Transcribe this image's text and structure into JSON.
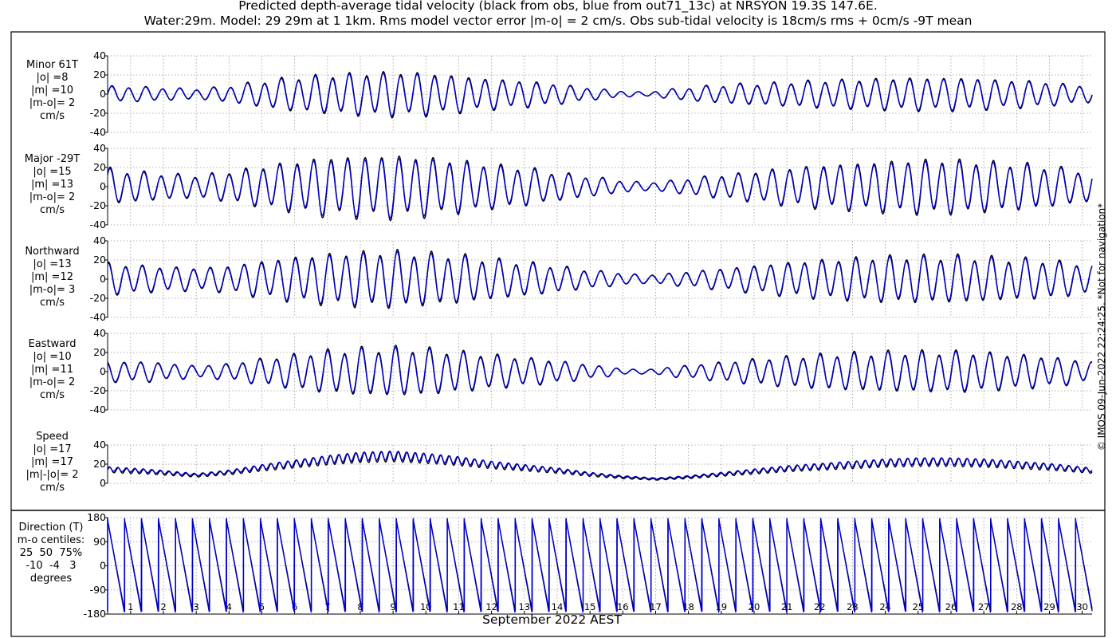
{
  "title": {
    "line1": "Predicted depth-average tidal velocity (black from obs, blue from out71_13c) at NRSYON 19.3S 147.6E.",
    "line2": "Water:29m. Model: 29 29m at 1 1km. Rms model vector error |m-o| = 2 cm/s. Obs sub-tidal velocity is 18cm/s rms + 0cm/s -9T mean"
  },
  "xlabel": "September 2022 AEST",
  "footer": "© IMOS 09-Jun-2022 22:24:25. *Not for navigation*",
  "colors": {
    "obs": "#000000",
    "model": "#0000cc",
    "grid": "#999999"
  },
  "panels": [
    {
      "id": "minor",
      "label_lines": [
        "Minor 61T",
        "|o| =8",
        "|m| =10",
        "|m-o|= 2",
        "cm/s"
      ],
      "yticks": [
        "40",
        "20",
        "0",
        "-20",
        "-40"
      ]
    },
    {
      "id": "major",
      "label_lines": [
        "Major -29T",
        "|o| =15",
        "|m| =13",
        "|m-o|= 2",
        "cm/s"
      ],
      "yticks": [
        "40",
        "20",
        "0",
        "-20",
        "-40"
      ]
    },
    {
      "id": "northward",
      "label_lines": [
        "Northward",
        "|o| =13",
        "|m| =12",
        "|m-o|= 3",
        "cm/s"
      ],
      "yticks": [
        "40",
        "20",
        "0",
        "-20",
        "-40"
      ]
    },
    {
      "id": "eastward",
      "label_lines": [
        "Eastward",
        "|o| =10",
        "|m| =11",
        "|m-o|= 2",
        "cm/s"
      ],
      "yticks": [
        "40",
        "20",
        "0",
        "-20",
        "-40"
      ]
    },
    {
      "id": "speed",
      "label_lines": [
        "Speed",
        "|o| =17",
        "|m| =17",
        "|m|-|o|= 2",
        "cm/s"
      ],
      "yticks": [
        "40",
        "20",
        "0"
      ]
    },
    {
      "id": "direction",
      "label_lines": [
        "Direction (T)",
        "m-o centiles:",
        "25  50  75%",
        "-10  -4   3",
        "degrees"
      ],
      "yticks": [
        "180",
        "90",
        "0",
        "-90",
        "-180"
      ]
    }
  ],
  "chart_data": {
    "type": "line",
    "x": {
      "label": "September 2022 AEST",
      "ticks": [
        "1",
        "2",
        "3",
        "4",
        "5",
        "6",
        "7",
        "8",
        "9",
        "10",
        "11",
        "12",
        "13",
        "14",
        "15",
        "16",
        "17",
        "18",
        "19",
        "20",
        "21",
        "22",
        "23",
        "24",
        "25",
        "26",
        "27",
        "28",
        "29",
        "30"
      ],
      "range_days": [
        0.3,
        30.3
      ]
    },
    "series_legend": [
      "black from obs",
      "blue from out71_13c"
    ],
    "panels": [
      {
        "name": "Minor 61T",
        "ylim": [
          -40,
          40
        ],
        "tidal_period_hours": 12.42,
        "amplitude_envelope_cm_s": [
          [
            0.3,
            8
          ],
          [
            1.5,
            7
          ],
          [
            3,
            5
          ],
          [
            4,
            8
          ],
          [
            5,
            13
          ],
          [
            6,
            17
          ],
          [
            7,
            19
          ],
          [
            8,
            21
          ],
          [
            9,
            22
          ],
          [
            10,
            21
          ],
          [
            11,
            18
          ],
          [
            12,
            15
          ],
          [
            13,
            13
          ],
          [
            14,
            10
          ],
          [
            15,
            6
          ],
          [
            16,
            3
          ],
          [
            16.7,
            2
          ],
          [
            17.5,
            5
          ],
          [
            18.5,
            8
          ],
          [
            19.5,
            10
          ],
          [
            20.5,
            11
          ],
          [
            21.5,
            13
          ],
          [
            22.5,
            14
          ],
          [
            23.5,
            15
          ],
          [
            24.5,
            16
          ],
          [
            25.5,
            16
          ],
          [
            26.5,
            16
          ],
          [
            27.5,
            14
          ],
          [
            28.5,
            13
          ],
          [
            29.5,
            10
          ],
          [
            30.3,
            8
          ]
        ]
      },
      {
        "name": "Major -29T",
        "ylim": [
          -40,
          40
        ],
        "tidal_period_hours": 12.42,
        "amplitude_envelope_cm_s": [
          [
            0.3,
            18
          ],
          [
            1.5,
            14
          ],
          [
            3,
            11
          ],
          [
            4,
            15
          ],
          [
            5,
            20
          ],
          [
            6,
            25
          ],
          [
            7,
            29
          ],
          [
            8,
            30
          ],
          [
            9,
            31
          ],
          [
            10,
            29
          ],
          [
            11,
            26
          ],
          [
            12,
            22
          ],
          [
            13,
            19
          ],
          [
            14,
            14
          ],
          [
            15,
            10
          ],
          [
            16,
            6
          ],
          [
            16.7,
            4
          ],
          [
            17.5,
            6
          ],
          [
            18.5,
            10
          ],
          [
            19.5,
            13
          ],
          [
            20.5,
            17
          ],
          [
            21.5,
            20
          ],
          [
            22.5,
            22
          ],
          [
            23.5,
            24
          ],
          [
            24.5,
            26
          ],
          [
            25.5,
            27
          ],
          [
            26.5,
            26
          ],
          [
            27.5,
            24
          ],
          [
            28.5,
            22
          ],
          [
            29.5,
            18
          ],
          [
            30.3,
            15
          ]
        ]
      },
      {
        "name": "Northward",
        "ylim": [
          -40,
          40
        ],
        "tidal_period_hours": 12.42,
        "amplitude_envelope_cm_s": [
          [
            0.3,
            16
          ],
          [
            1.5,
            13
          ],
          [
            3,
            11
          ],
          [
            4,
            13
          ],
          [
            5,
            18
          ],
          [
            6,
            22
          ],
          [
            7,
            25
          ],
          [
            8,
            27
          ],
          [
            9,
            28
          ],
          [
            10,
            26
          ],
          [
            11,
            24
          ],
          [
            12,
            20
          ],
          [
            13,
            17
          ],
          [
            14,
            13
          ],
          [
            15,
            9
          ],
          [
            16,
            6
          ],
          [
            16.7,
            4
          ],
          [
            17.5,
            6
          ],
          [
            18.5,
            9
          ],
          [
            19.5,
            12
          ],
          [
            20.5,
            15
          ],
          [
            21.5,
            18
          ],
          [
            22.5,
            20
          ],
          [
            23.5,
            22
          ],
          [
            24.5,
            23
          ],
          [
            25.5,
            23
          ],
          [
            26.5,
            23
          ],
          [
            27.5,
            21
          ],
          [
            28.5,
            20
          ],
          [
            29.5,
            17
          ],
          [
            30.3,
            14
          ]
        ]
      },
      {
        "name": "Eastward",
        "ylim": [
          -40,
          40
        ],
        "tidal_period_hours": 12.42,
        "amplitude_envelope_cm_s": [
          [
            0.3,
            10
          ],
          [
            1.5,
            10
          ],
          [
            3,
            6
          ],
          [
            4,
            8
          ],
          [
            5,
            13
          ],
          [
            6,
            17
          ],
          [
            7,
            21
          ],
          [
            8,
            23
          ],
          [
            9,
            24
          ],
          [
            10,
            23
          ],
          [
            11,
            20
          ],
          [
            12,
            17
          ],
          [
            13,
            14
          ],
          [
            14,
            11
          ],
          [
            15,
            7
          ],
          [
            16,
            3
          ],
          [
            16.7,
            2
          ],
          [
            17.5,
            5
          ],
          [
            18.5,
            8
          ],
          [
            19.5,
            11
          ],
          [
            20.5,
            14
          ],
          [
            21.5,
            16
          ],
          [
            22.5,
            18
          ],
          [
            23.5,
            19
          ],
          [
            24.5,
            20
          ],
          [
            25.5,
            20
          ],
          [
            26.5,
            20
          ],
          [
            27.5,
            18
          ],
          [
            28.5,
            16
          ],
          [
            29.5,
            13
          ],
          [
            30.3,
            10
          ]
        ]
      },
      {
        "name": "Speed",
        "ylim": [
          0,
          40
        ],
        "mean_envelope_cm_s": [
          [
            0.3,
            14
          ],
          [
            1.5,
            12
          ],
          [
            3,
            8
          ],
          [
            4,
            11
          ],
          [
            5,
            16
          ],
          [
            6,
            20
          ],
          [
            7,
            24
          ],
          [
            8,
            27
          ],
          [
            9,
            28
          ],
          [
            10,
            26
          ],
          [
            11,
            23
          ],
          [
            12,
            19
          ],
          [
            13,
            16
          ],
          [
            14,
            13
          ],
          [
            15,
            9
          ],
          [
            16,
            6
          ],
          [
            17,
            4
          ],
          [
            18,
            6
          ],
          [
            19,
            9
          ],
          [
            20,
            12
          ],
          [
            21,
            15
          ],
          [
            22,
            17
          ],
          [
            23,
            19
          ],
          [
            24,
            21
          ],
          [
            25,
            22
          ],
          [
            26,
            22
          ],
          [
            27,
            21
          ],
          [
            28,
            19
          ],
          [
            29,
            17
          ],
          [
            30.3,
            13
          ]
        ]
      },
      {
        "name": "Direction (T)",
        "ylim": [
          -180,
          180
        ],
        "tidal_period_hours": 12.42,
        "pattern": "sawtooth, wraps from +180 to -180 each tidal cycle"
      }
    ]
  }
}
